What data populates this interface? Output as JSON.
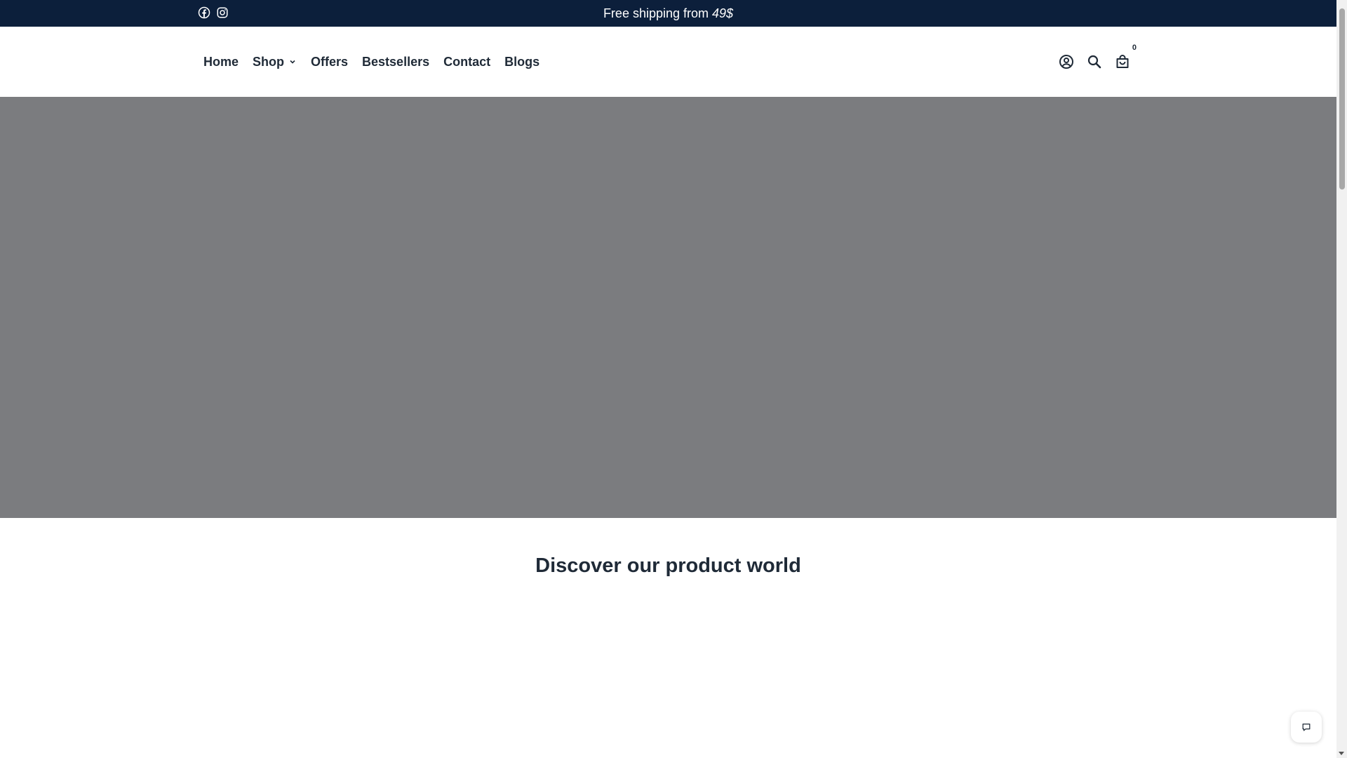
{
  "announcement": {
    "text_prefix": "Free shipping from ",
    "amount": "49$",
    "background": "#0c1f3b"
  },
  "socials": [
    {
      "name": "facebook-icon"
    },
    {
      "name": "instagram-icon"
    }
  ],
  "nav": {
    "items": [
      {
        "label": "Home"
      },
      {
        "label": "Shop"
      },
      {
        "label": "Offers"
      },
      {
        "label": "Bestsellers"
      },
      {
        "label": "Contact"
      },
      {
        "label": "Blogs"
      }
    ]
  },
  "header_icons": {
    "account": "user-circle-icon",
    "search": "search-icon",
    "cart": "shopping-bag-icon",
    "cart_count": "0"
  },
  "hero": {
    "background": "#7b7c7f"
  },
  "section": {
    "title": "Discover our product world"
  },
  "chat": {
    "icon": "chat-bubble-icon"
  }
}
